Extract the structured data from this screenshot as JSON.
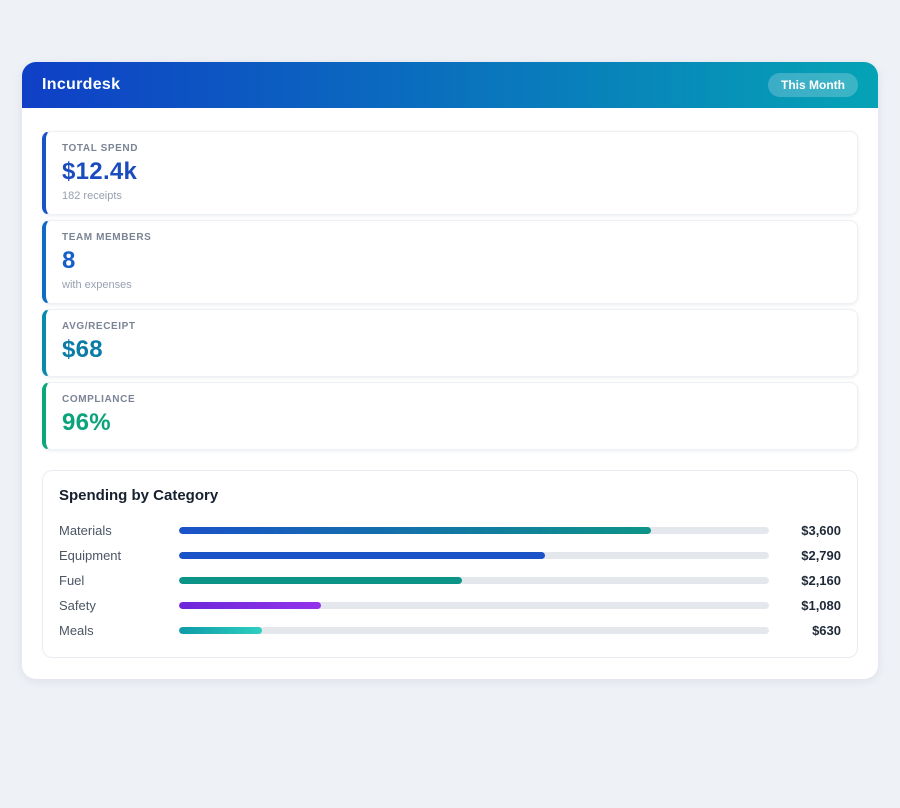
{
  "theme": {
    "page_bg": "#eef1f6",
    "header_gradient": [
      "#0f3fc6",
      "#05a3b5"
    ],
    "track_color": "#e4e7ec"
  },
  "header": {
    "title": "Incurdesk",
    "badge": "This Month"
  },
  "stats": [
    {
      "label": "TOTAL SPEND",
      "value": "$12.4k",
      "sub": "182 receipts",
      "accent": "#1a52c8",
      "value_color": "#1a4cc0"
    },
    {
      "label": "TEAM MEMBERS",
      "value": "8",
      "sub": "with expenses",
      "accent": "#0e6ac2",
      "value_color": "#155fc9"
    },
    {
      "label": "AVG/RECEIPT",
      "value": "$68",
      "sub": "",
      "accent": "#0a8aab",
      "value_color": "#0b7ca8"
    },
    {
      "label": "COMPLIANCE",
      "value": "96%",
      "sub": "",
      "accent": "#0ca678",
      "value_color": "#0aa37a"
    }
  ],
  "spending": {
    "title": "Spending by Category",
    "max_value": 3600,
    "max_fill_percent": 80,
    "rows": [
      {
        "label": "Materials",
        "amount": "$3,600",
        "value": 3600,
        "colors": [
          "#1a52c8",
          "#0d9488"
        ]
      },
      {
        "label": "Equipment",
        "amount": "$2,790",
        "value": 2790,
        "colors": [
          "#1a52c8"
        ]
      },
      {
        "label": "Fuel",
        "amount": "$2,160",
        "value": 2160,
        "colors": [
          "#0d9488"
        ]
      },
      {
        "label": "Safety",
        "amount": "$1,080",
        "value": 1080,
        "colors": [
          "#6d28d9",
          "#9333ea"
        ]
      },
      {
        "label": "Meals",
        "amount": "$630",
        "value": 630,
        "colors": [
          "#0e9aa8",
          "#2fd0c0"
        ]
      }
    ]
  }
}
